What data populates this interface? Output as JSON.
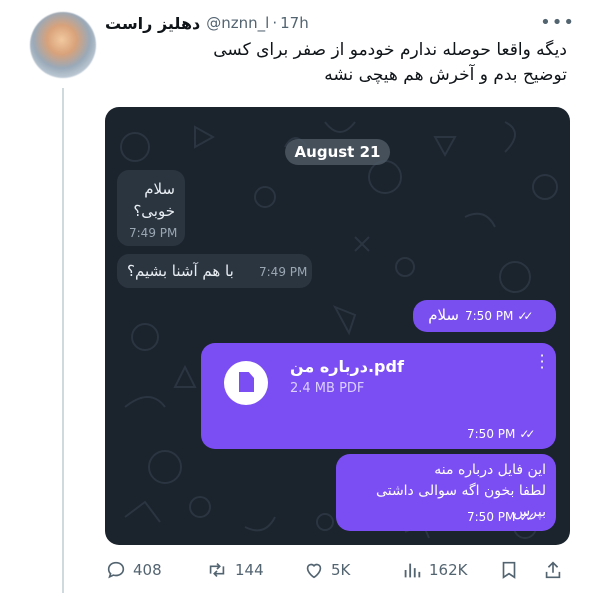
{
  "tweet": {
    "display_name": "دهلیز راست",
    "handle": "@nznn_l",
    "separator": "·",
    "time": "17h",
    "more": "•••",
    "text_lines": [
      "دیگه واقعا حوصله ندارم خودمو از صفر برای کسی",
      "توضیح بدم و آخرش هم هیچی نشه"
    ]
  },
  "chat": {
    "date": "August 21",
    "incoming": [
      {
        "lines": [
          "سلام",
          "خوبی؟"
        ],
        "time": "7:49 PM"
      },
      {
        "lines": [
          "با هم آشنا بشیم؟"
        ],
        "time": "7:49 PM"
      }
    ],
    "outgoing_text_1": {
      "text": "سلام",
      "time": "7:50 PM",
      "status": "✓✓"
    },
    "file": {
      "name": "درباره من.pdf",
      "size": "2.4 MB PDF",
      "time": "7:50 PM",
      "status": "✓✓",
      "icon": "document-icon"
    },
    "outgoing_text_2": {
      "lines": [
        "این فایل درباره منه",
        "لطفا بخون اگه سوالی داشتی بپرس"
      ],
      "time": "7:50 PM",
      "status": "✓✓"
    },
    "colors": {
      "background": "#1b232c",
      "incoming": "#2b3540",
      "outgoing": "#7b4ef4"
    }
  },
  "actions": {
    "replies": "408",
    "reposts": "144",
    "likes": "5K",
    "views": "162K",
    "icons": [
      "reply-icon",
      "repost-icon",
      "like-icon",
      "views-icon",
      "bookmark-icon",
      "share-icon"
    ]
  }
}
